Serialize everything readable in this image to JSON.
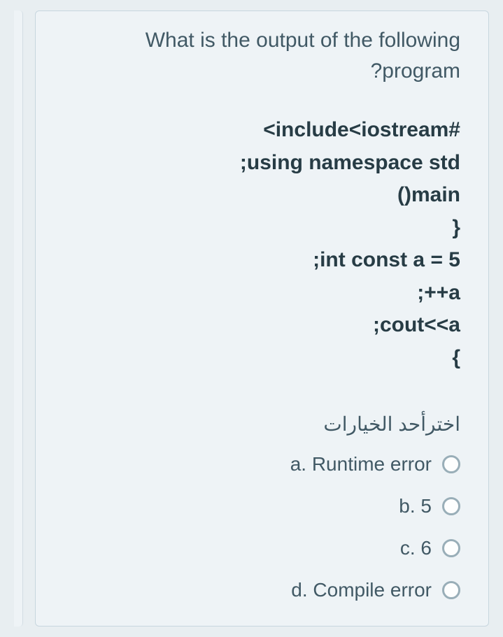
{
  "question": {
    "text_line1": "What is the output of the following",
    "text_line2": "?program"
  },
  "code": {
    "line1": "<include<iostream#",
    "line2": ";using namespace std",
    "line3": "()main",
    "line4": "}",
    "line5": ";int const a = 5",
    "line6": ";++a",
    "line7": ";cout<<a",
    "line8": "{"
  },
  "prompt": "اخترأحد الخيارات",
  "options": {
    "a": "a. Runtime error",
    "b": "b. 5",
    "c": "c. 6",
    "d": "d. Compile error"
  }
}
